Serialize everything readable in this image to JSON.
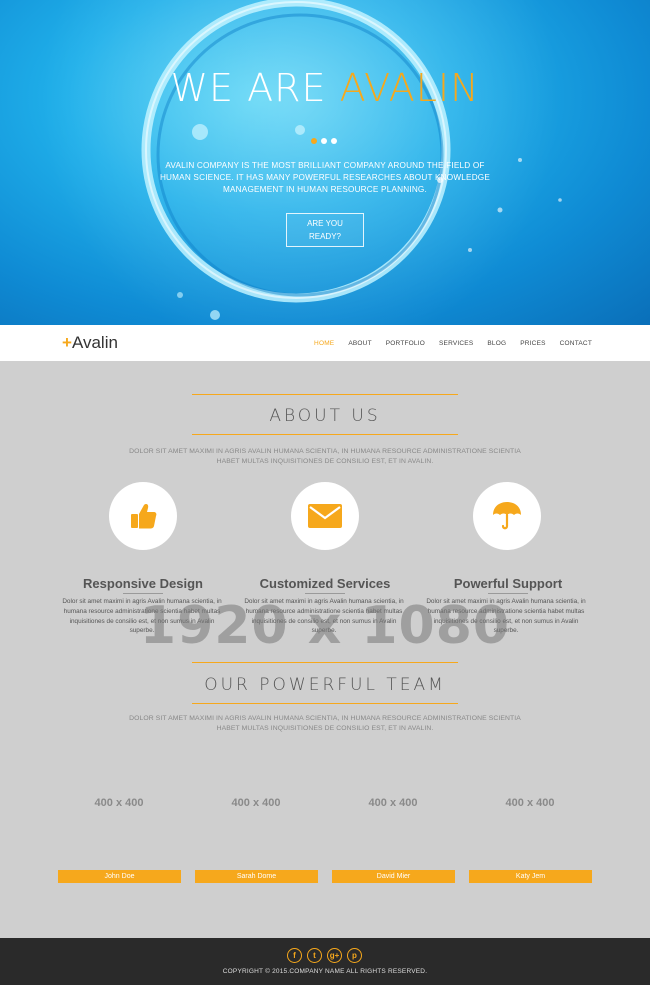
{
  "hero": {
    "title_main": "WE ARE ",
    "title_accent": "AVALIN",
    "description": "AVALIN COMPANY IS THE MOST BRILLIANT COMPANY AROUND THE FIELD OF HUMAN SCIENCE. IT HAS MANY POWERFUL RESEARCHES ABOUT KNOWLEDGE MANAGEMENT IN HUMAN RESOURCE PLANNING.",
    "button_line1": "ARE YOU",
    "button_line2": "READY?",
    "slider_dots": 3,
    "active_dot": 1
  },
  "navbar": {
    "logo_plus": "+",
    "logo_text": "Avalin",
    "items": [
      "HOME",
      "ABOUT",
      "PORTFOLIO",
      "SERVICES",
      "BLOG",
      "PRICES",
      "CONTACT"
    ],
    "active_index": 0
  },
  "about": {
    "title": "ABOUT US",
    "description": "DOLOR SIT AMET MAXIMI IN AGRIS AVALIN HUMANA SCIENTIA, IN HUMANA RESOURCE ADMINISTRATIONE SCIENTIA HABET MULTAS INQUISITIONES DE CONSILIO EST, ET IN AVALIN.",
    "features": [
      {
        "icon": "thumbs-up-icon",
        "title": "Responsive Design",
        "text": "Dolor sit amet maximi in agris Avalin humana scientia, in humana resource administratione scientia habet multas inquisitiones de consilio est, et non sumus in Avalin superbe."
      },
      {
        "icon": "envelope-icon",
        "title": "Customized Services",
        "text": "Dolor sit amet maximi in agris Avalin humana scientia, in humana resource administratione scientia habet multas inquisitiones de consilio est, et non sumus in Avalin superbe."
      },
      {
        "icon": "umbrella-icon",
        "title": "Powerful Support",
        "text": "Dolor sit amet maximi in agris Avalin humana scientia, in humana resource administratione scientia habet multas inquisitiones de consilio est, et non sumus in Avalin superbe."
      }
    ]
  },
  "watermark": "1920 x 1080",
  "team": {
    "title": "OUR POWERFUL TEAM",
    "description": "DOLOR SIT AMET MAXIMI IN AGRIS AVALIN HUMANA SCIENTIA, IN HUMANA RESOURCE ADMINISTRATIONE SCIENTIA HABET MULTAS INQUISITIONES DE CONSILIO EST, ET IN AVALIN.",
    "members": [
      {
        "photo": "400 x 400",
        "name": "John Doe"
      },
      {
        "photo": "400 x 400",
        "name": "Sarah Dome"
      },
      {
        "photo": "400 x 400",
        "name": "David Mier"
      },
      {
        "photo": "400 x 400",
        "name": "Katy Jem"
      }
    ]
  },
  "footer": {
    "socials": [
      {
        "icon": "facebook-icon",
        "glyph": "f"
      },
      {
        "icon": "twitter-icon",
        "glyph": "t"
      },
      {
        "icon": "google-plus-icon",
        "glyph": "g+"
      },
      {
        "icon": "pinterest-icon",
        "glyph": "p"
      }
    ],
    "copyright": "COPYRIGHT © 2015.COMPANY NAME ALL RIGHTS RESERVED."
  },
  "colors": {
    "accent": "#f6a81c",
    "hero_blue": "#1fa9e8",
    "body_gray": "#cfcfcf",
    "footer": "#2a2a2a"
  }
}
